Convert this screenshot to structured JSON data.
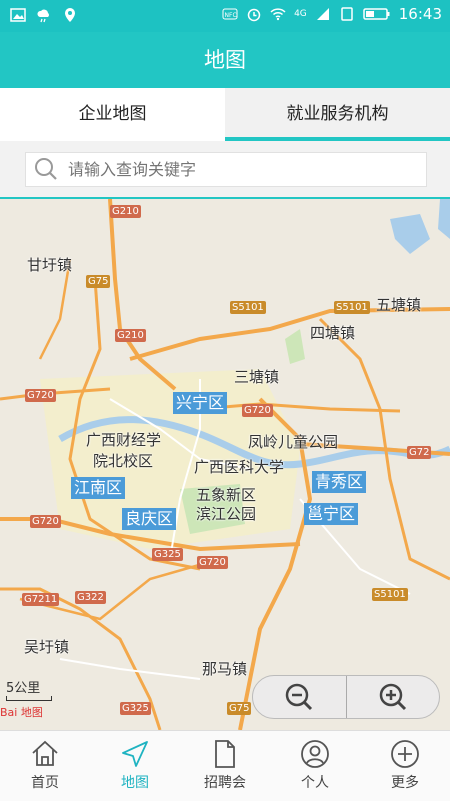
{
  "statusbar": {
    "time": "16:43",
    "network": "4G"
  },
  "header": {
    "title": "地图"
  },
  "tabs": [
    {
      "label": "企业地图"
    },
    {
      "label": "就业服务机构"
    }
  ],
  "search": {
    "placeholder": "请输入查询关键字"
  },
  "map": {
    "places": [
      "甘圩镇",
      "五塘镇",
      "四塘镇",
      "三塘镇",
      "广西财经学",
      "院北校区",
      "凤岭儿童公园",
      "广西医科大学",
      "五象新区",
      "滨江公园",
      "吴圩镇",
      "那马镇"
    ],
    "districts": [
      "兴宁区",
      "江南区",
      "良庆区",
      "青秀区",
      "邕宁区"
    ],
    "roads": [
      "G210",
      "G75",
      "S5101",
      "G210",
      "G720",
      "G720",
      "G72",
      "G720",
      "G325",
      "G720",
      "G7211",
      "G322",
      "S5101",
      "G75",
      "G325"
    ],
    "scale": "5公里",
    "attribution": "Bai 地图"
  },
  "nav": [
    {
      "label": "首页"
    },
    {
      "label": "地图"
    },
    {
      "label": "招聘会"
    },
    {
      "label": "个人"
    },
    {
      "label": "更多"
    }
  ],
  "colors": {
    "accent": "#22c6c4",
    "district": "#4b9bd8"
  }
}
